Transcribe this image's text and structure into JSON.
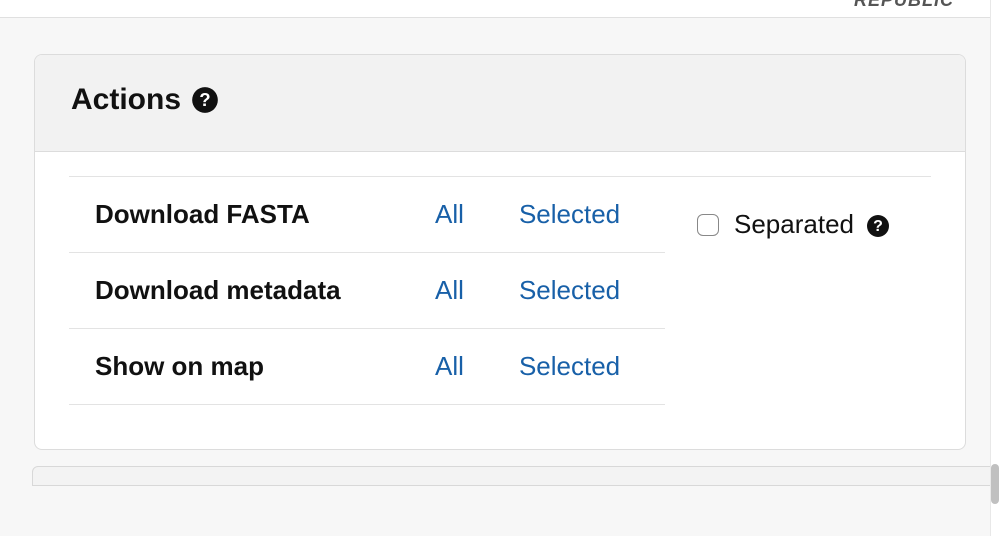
{
  "brand": "REPUBLIC",
  "panel": {
    "title": "Actions",
    "rows": [
      {
        "label": "Download FASTA",
        "all": "All",
        "selected": "Selected"
      },
      {
        "label": "Download metadata",
        "all": "All",
        "selected": "Selected"
      },
      {
        "label": "Show on map",
        "all": "All",
        "selected": "Selected"
      }
    ],
    "separated_label": "Separated"
  }
}
